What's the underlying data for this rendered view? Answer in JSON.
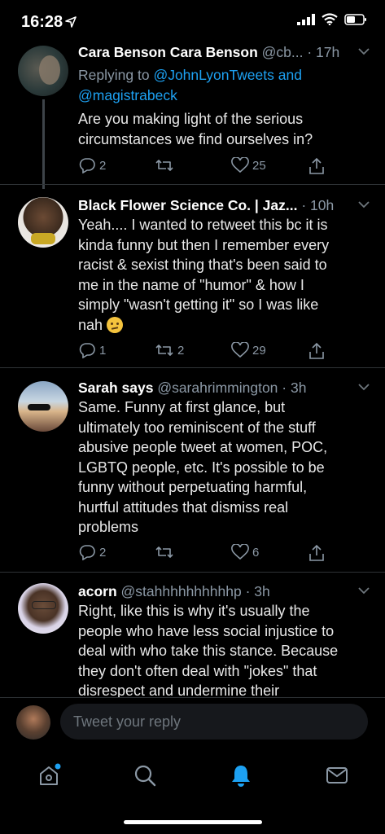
{
  "status_bar": {
    "time": "16:28"
  },
  "tweets": [
    {
      "display_name": "Cara Benson Cara Benson",
      "handle": "@cb...",
      "time": "· 17h",
      "replying_prefix": "Replying to",
      "replying_to_1": "@JohnLyonTweets and",
      "replying_to_2": "@magistrabeck",
      "text_lines": [
        "Are you making light of the serious",
        "circumstances we find ourselves in?"
      ],
      "replies": "2",
      "retweets": "",
      "likes": "25"
    },
    {
      "display_name": "Black Flower Science Co. | Jaz...",
      "handle": "",
      "time": "· 10h",
      "text_lines": [
        "Yeah.... I wanted to retweet this bc it is",
        "kinda funny but then I remember every",
        "racist & sexist thing that's been said to",
        "me in the name of \"humor\" & how I",
        "simply \"wasn't getting it\" so I was like",
        "nah"
      ],
      "emoji": "confused-face",
      "replies": "1",
      "retweets": "2",
      "likes": "29"
    },
    {
      "display_name": "Sarah says",
      "handle": "@sarahrimmington",
      "time": "· 3h",
      "text_lines": [
        "Same. Funny at first glance, but",
        "ultimately too reminiscent of the stuff",
        "abusive people tweet at women, POC,",
        "LGBTQ people, etc. It's possible to be",
        "funny without perpetuating harmful,",
        "hurtful attitudes that dismiss real",
        "problems"
      ],
      "replies": "2",
      "retweets": "",
      "likes": "6"
    },
    {
      "display_name": "acorn",
      "handle": "@stahhhhhhhhhhp",
      "time": "· 3h",
      "text_lines": [
        "Right, like this is why it's usually the",
        "people who have less social injustice to",
        "deal with who take this stance. Because",
        "they don't often deal with \"jokes\" that",
        "disrespect and undermine their"
      ]
    }
  ],
  "reply_bar": {
    "placeholder": "Tweet your reply"
  },
  "tabs": [
    "home-icon",
    "search-icon",
    "notifications-icon",
    "messages-icon"
  ],
  "colors": {
    "background": "#000000",
    "accent": "#1da1f2",
    "muted": "#8b98a5"
  }
}
